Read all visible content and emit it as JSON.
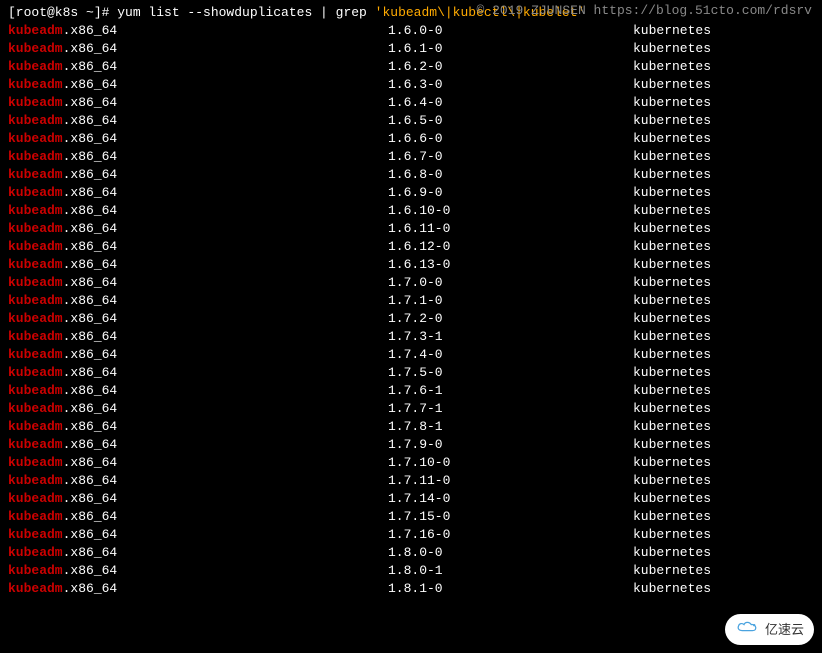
{
  "prompt": "[root@k8s ~]# ",
  "command_pre": "yum list --showduplicates | grep ",
  "command_quoted": "'kubeadm\\|kubectl\\|kubelet'",
  "watermark": "© 2019 ZJUNSEN https://blog.51cto.com/rdsrv",
  "badge_text": "亿速云",
  "rows": [
    {
      "name": "kubeadm",
      "arch": ".x86_64",
      "version": "1.6.0-0",
      "repo": "kubernetes"
    },
    {
      "name": "kubeadm",
      "arch": ".x86_64",
      "version": "1.6.1-0",
      "repo": "kubernetes"
    },
    {
      "name": "kubeadm",
      "arch": ".x86_64",
      "version": "1.6.2-0",
      "repo": "kubernetes"
    },
    {
      "name": "kubeadm",
      "arch": ".x86_64",
      "version": "1.6.3-0",
      "repo": "kubernetes"
    },
    {
      "name": "kubeadm",
      "arch": ".x86_64",
      "version": "1.6.4-0",
      "repo": "kubernetes"
    },
    {
      "name": "kubeadm",
      "arch": ".x86_64",
      "version": "1.6.5-0",
      "repo": "kubernetes"
    },
    {
      "name": "kubeadm",
      "arch": ".x86_64",
      "version": "1.6.6-0",
      "repo": "kubernetes"
    },
    {
      "name": "kubeadm",
      "arch": ".x86_64",
      "version": "1.6.7-0",
      "repo": "kubernetes"
    },
    {
      "name": "kubeadm",
      "arch": ".x86_64",
      "version": "1.6.8-0",
      "repo": "kubernetes"
    },
    {
      "name": "kubeadm",
      "arch": ".x86_64",
      "version": "1.6.9-0",
      "repo": "kubernetes"
    },
    {
      "name": "kubeadm",
      "arch": ".x86_64",
      "version": "1.6.10-0",
      "repo": "kubernetes"
    },
    {
      "name": "kubeadm",
      "arch": ".x86_64",
      "version": "1.6.11-0",
      "repo": "kubernetes"
    },
    {
      "name": "kubeadm",
      "arch": ".x86_64",
      "version": "1.6.12-0",
      "repo": "kubernetes"
    },
    {
      "name": "kubeadm",
      "arch": ".x86_64",
      "version": "1.6.13-0",
      "repo": "kubernetes"
    },
    {
      "name": "kubeadm",
      "arch": ".x86_64",
      "version": "1.7.0-0",
      "repo": "kubernetes"
    },
    {
      "name": "kubeadm",
      "arch": ".x86_64",
      "version": "1.7.1-0",
      "repo": "kubernetes"
    },
    {
      "name": "kubeadm",
      "arch": ".x86_64",
      "version": "1.7.2-0",
      "repo": "kubernetes"
    },
    {
      "name": "kubeadm",
      "arch": ".x86_64",
      "version": "1.7.3-1",
      "repo": "kubernetes"
    },
    {
      "name": "kubeadm",
      "arch": ".x86_64",
      "version": "1.7.4-0",
      "repo": "kubernetes"
    },
    {
      "name": "kubeadm",
      "arch": ".x86_64",
      "version": "1.7.5-0",
      "repo": "kubernetes"
    },
    {
      "name": "kubeadm",
      "arch": ".x86_64",
      "version": "1.7.6-1",
      "repo": "kubernetes"
    },
    {
      "name": "kubeadm",
      "arch": ".x86_64",
      "version": "1.7.7-1",
      "repo": "kubernetes"
    },
    {
      "name": "kubeadm",
      "arch": ".x86_64",
      "version": "1.7.8-1",
      "repo": "kubernetes"
    },
    {
      "name": "kubeadm",
      "arch": ".x86_64",
      "version": "1.7.9-0",
      "repo": "kubernetes"
    },
    {
      "name": "kubeadm",
      "arch": ".x86_64",
      "version": "1.7.10-0",
      "repo": "kubernetes"
    },
    {
      "name": "kubeadm",
      "arch": ".x86_64",
      "version": "1.7.11-0",
      "repo": "kubernetes"
    },
    {
      "name": "kubeadm",
      "arch": ".x86_64",
      "version": "1.7.14-0",
      "repo": "kubernetes"
    },
    {
      "name": "kubeadm",
      "arch": ".x86_64",
      "version": "1.7.15-0",
      "repo": "kubernetes"
    },
    {
      "name": "kubeadm",
      "arch": ".x86_64",
      "version": "1.7.16-0",
      "repo": "kubernetes"
    },
    {
      "name": "kubeadm",
      "arch": ".x86_64",
      "version": "1.8.0-0",
      "repo": "kubernetes"
    },
    {
      "name": "kubeadm",
      "arch": ".x86_64",
      "version": "1.8.0-1",
      "repo": "kubernetes"
    },
    {
      "name": "kubeadm",
      "arch": ".x86_64",
      "version": "1.8.1-0",
      "repo": "kubernetes"
    }
  ]
}
